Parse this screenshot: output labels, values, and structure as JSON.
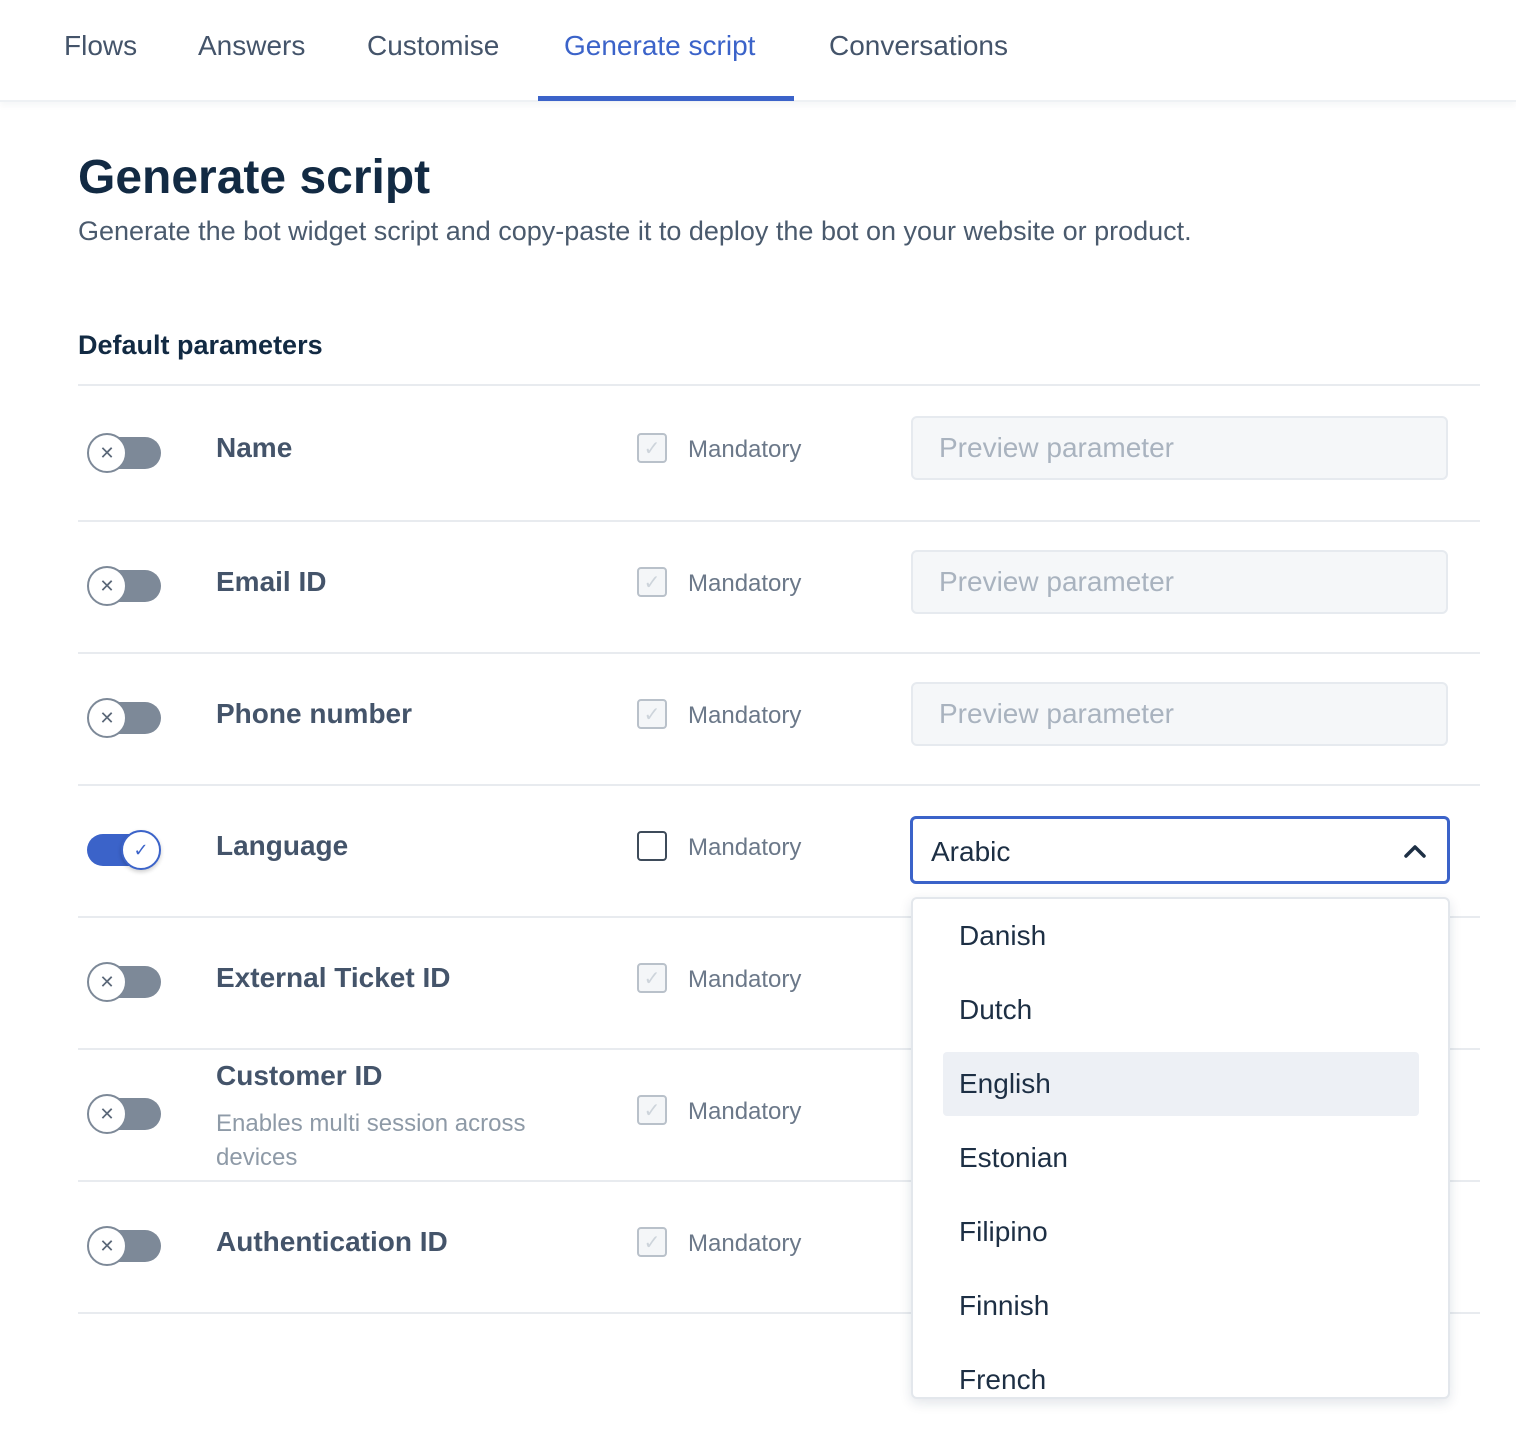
{
  "nav": {
    "tabs": [
      {
        "label": "Flows"
      },
      {
        "label": "Answers"
      },
      {
        "label": "Customise"
      },
      {
        "label": "Generate script"
      },
      {
        "label": "Conversations"
      }
    ],
    "active_tab": "Generate script"
  },
  "page": {
    "title": "Generate script",
    "description": "Generate the bot widget script and copy-paste it to deploy the bot on your website or product."
  },
  "section": {
    "title": "Default parameters"
  },
  "params": [
    {
      "label": "Name",
      "enabled": false,
      "mandatory_label": "Mandatory",
      "mandatory": false,
      "placeholder": "Preview parameter"
    },
    {
      "label": "Email ID",
      "enabled": false,
      "mandatory_label": "Mandatory",
      "mandatory": false,
      "placeholder": "Preview parameter"
    },
    {
      "label": "Phone number",
      "enabled": false,
      "mandatory_label": "Mandatory",
      "mandatory": false,
      "placeholder": "Preview parameter"
    },
    {
      "label": "Language",
      "enabled": true,
      "mandatory_label": "Mandatory",
      "mandatory": false,
      "selected": "Arabic"
    },
    {
      "label": "External Ticket ID",
      "enabled": false,
      "mandatory_label": "Mandatory",
      "mandatory": false
    },
    {
      "label": "Customer ID",
      "hint": "Enables multi session across devices",
      "enabled": false,
      "mandatory_label": "Mandatory",
      "mandatory": false
    },
    {
      "label": "Authentication ID",
      "enabled": false,
      "mandatory_label": "Mandatory",
      "mandatory": false
    }
  ],
  "language_dropdown": {
    "options": [
      "Danish",
      "Dutch",
      "English",
      "Estonian",
      "Filipino",
      "Finnish",
      "French"
    ],
    "highlighted": "English"
  },
  "icons": {
    "toggle_off": "close-icon",
    "toggle_on": "check-icon",
    "select_chevron": "chevron-up-icon"
  },
  "colors": {
    "accent": "#3b63c9",
    "toggle_off": "#7d8998",
    "heading": "#122a43"
  }
}
